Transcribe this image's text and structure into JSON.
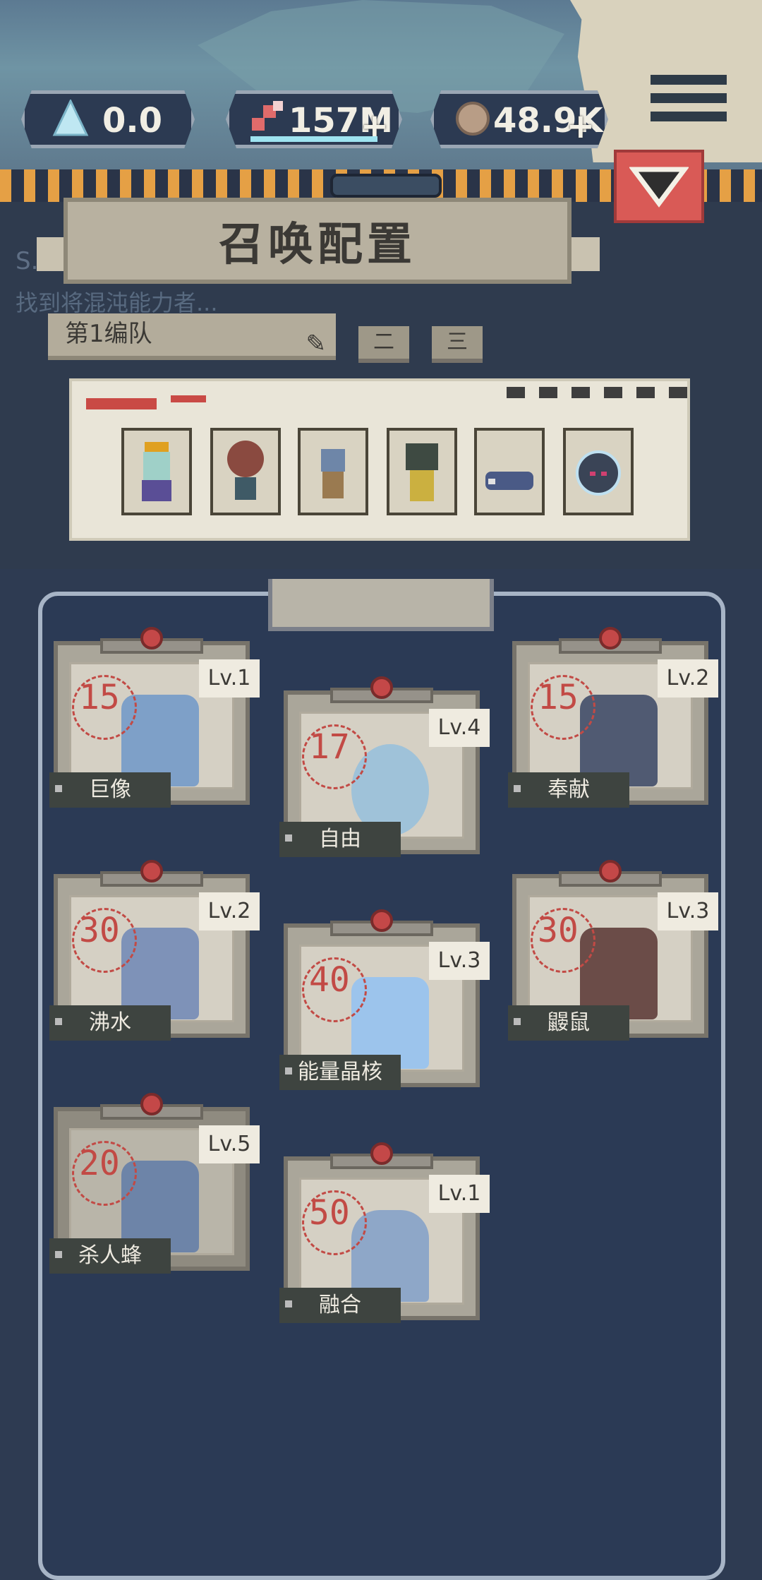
{
  "currencies": [
    {
      "name": "crystal",
      "value": "0.0",
      "icon": "crystal-icon",
      "has_plus": false
    },
    {
      "name": "gene",
      "value": "157M",
      "icon": "dna-icon",
      "has_plus": true
    },
    {
      "name": "ore",
      "value": "48.9K",
      "icon": "ore-icon",
      "has_plus": true
    }
  ],
  "plus_label": "+",
  "menu_icon": "hamburger-menu-icon",
  "dropdown_icon": "triangle-down-icon",
  "faint_bg_text": {
    "line1": "S.O.",
    "line2": "找到将混沌能力者..."
  },
  "title": "召唤配置",
  "team": {
    "selected": "第1编队",
    "tabs": [
      "二",
      "三"
    ]
  },
  "squad_slots": [
    "slot-1",
    "slot-2",
    "slot-3",
    "slot-4",
    "slot-5",
    "slot-6"
  ],
  "cards": [
    {
      "name": "巨像",
      "cost": "15",
      "level": "Lv.1",
      "color": "#7ea0c8"
    },
    {
      "name": "自由",
      "cost": "17",
      "level": "Lv.4",
      "color": "#9fc2d9"
    },
    {
      "name": "奉献",
      "cost": "15",
      "level": "Lv.2",
      "color": "#505a72"
    },
    {
      "name": "沸水",
      "cost": "30",
      "level": "Lv.2",
      "color": "#7e92b8"
    },
    {
      "name": "能量晶核",
      "cost": "40",
      "level": "Lv.3",
      "color": "#9cc4ec"
    },
    {
      "name": "鼹鼠",
      "cost": "30",
      "level": "Lv.3",
      "color": "#6b4c48"
    },
    {
      "name": "杀人蜂",
      "cost": "20",
      "level": "Lv.5",
      "color": "#6d84a8"
    },
    {
      "name": "融合",
      "cost": "50",
      "level": "Lv.1",
      "color": "#8ea7c8"
    }
  ]
}
